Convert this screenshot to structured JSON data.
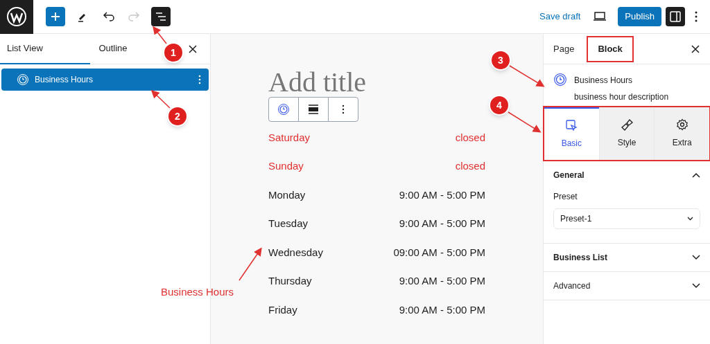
{
  "top_bar": {
    "redo_disabled": true,
    "list_view_on": true,
    "settings_on": true,
    "save_draft": "Save draft",
    "publish": "Publish"
  },
  "left_panel": {
    "tabs": [
      {
        "label": "List View",
        "selected": true
      },
      {
        "label": "Outline",
        "selected": false
      }
    ],
    "items": [
      {
        "label": "Business Hours",
        "selected": true
      }
    ]
  },
  "editor": {
    "title_placeholder": "Add title",
    "hours": [
      {
        "day": "Saturday",
        "time": "closed",
        "closed": true
      },
      {
        "day": "Sunday",
        "time": "closed",
        "closed": true
      },
      {
        "day": "Monday",
        "time": "9:00 AM - 5:00 PM",
        "closed": false
      },
      {
        "day": "Tuesday",
        "time": "9:00 AM - 5:00 PM",
        "closed": false
      },
      {
        "day": "Wednesday",
        "time": "09:00 AM - 5:00 PM",
        "closed": false
      },
      {
        "day": "Thursday",
        "time": "9:00 AM - 5:00 PM",
        "closed": false
      },
      {
        "day": "Friday",
        "time": "9:00 AM - 5:00 PM",
        "closed": false
      }
    ]
  },
  "right_panel": {
    "tabs": [
      {
        "label": "Page",
        "selected": false,
        "highlighted": false
      },
      {
        "label": "Block",
        "selected": true,
        "highlighted": true
      }
    ],
    "block": {
      "name": "Business Hours",
      "description": "business hour description"
    },
    "style_tabs_highlighted": true,
    "style_tabs": [
      {
        "label": "Basic",
        "kind": "cursor",
        "selected": true
      },
      {
        "label": "Style",
        "kind": "brush",
        "selected": false
      },
      {
        "label": "Extra",
        "kind": "gear",
        "selected": false
      }
    ],
    "sections": [
      {
        "title": "General",
        "bold": true,
        "expanded": true,
        "field_label": "Preset",
        "field_value": "Preset-1"
      },
      {
        "title": "Business List",
        "bold": true,
        "expanded": false
      },
      {
        "title": "Advanced",
        "bold": false,
        "expanded": false
      }
    ]
  },
  "annotations": {
    "badges": [
      "1",
      "2",
      "3",
      "4"
    ],
    "label": "Business Hours"
  }
}
